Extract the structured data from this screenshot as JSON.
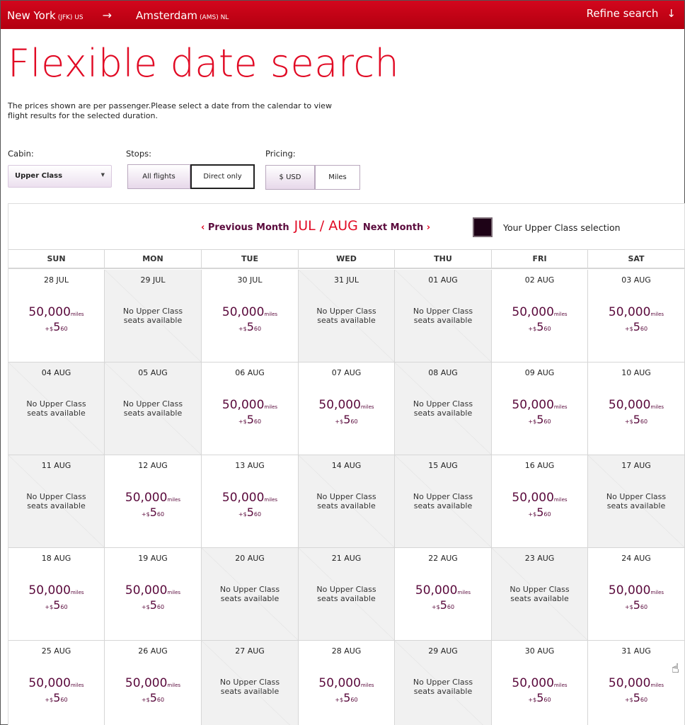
{
  "header": {
    "origin_city": "New York",
    "origin_code": "(JFK) US",
    "arrow": "→",
    "dest_city": "Amsterdam",
    "dest_code": "(AMS) NL",
    "refine_label": "Refine search",
    "refine_icon": "↓"
  },
  "title": "Flexible date search",
  "description": "The prices shown are per passenger.Please select a date from the calendar to view flight results for the selected duration.",
  "filters": {
    "cabin_label": "Cabin:",
    "cabin_value": "Upper Class",
    "stops_label": "Stops:",
    "stops_options": [
      "All flights",
      "Direct only"
    ],
    "pricing_label": "Pricing:",
    "pricing_options": [
      "$ USD",
      "Miles"
    ]
  },
  "calendar": {
    "prev_label": "Previous Month",
    "next_label": "Next Month",
    "month_label": "JUL / AUG",
    "legend_label": "Your Upper Class selection",
    "days_of_week": [
      "SUN",
      "MON",
      "TUE",
      "WED",
      "THU",
      "FRI",
      "SAT"
    ],
    "no_seats_text": "No Upper Class seats available",
    "price_miles": "50,000",
    "miles_unit": "miles",
    "tax_prefix": "+$",
    "tax_dollars": "5",
    "tax_cents": "60",
    "cells": [
      {
        "date": "28 JUL",
        "available": true
      },
      {
        "date": "29 JUL",
        "available": false
      },
      {
        "date": "30 JUL",
        "available": true
      },
      {
        "date": "31 JUL",
        "available": false
      },
      {
        "date": "01 AUG",
        "available": false
      },
      {
        "date": "02 AUG",
        "available": true
      },
      {
        "date": "03 AUG",
        "available": true
      },
      {
        "date": "04 AUG",
        "available": false
      },
      {
        "date": "05 AUG",
        "available": false
      },
      {
        "date": "06 AUG",
        "available": true
      },
      {
        "date": "07 AUG",
        "available": true
      },
      {
        "date": "08 AUG",
        "available": false
      },
      {
        "date": "09 AUG",
        "available": true
      },
      {
        "date": "10 AUG",
        "available": true
      },
      {
        "date": "11 AUG",
        "available": false
      },
      {
        "date": "12 AUG",
        "available": true
      },
      {
        "date": "13 AUG",
        "available": true
      },
      {
        "date": "14 AUG",
        "available": false
      },
      {
        "date": "15 AUG",
        "available": false
      },
      {
        "date": "16 AUG",
        "available": true
      },
      {
        "date": "17 AUG",
        "available": false
      },
      {
        "date": "18 AUG",
        "available": true
      },
      {
        "date": "19 AUG",
        "available": true
      },
      {
        "date": "20 AUG",
        "available": false
      },
      {
        "date": "21 AUG",
        "available": false
      },
      {
        "date": "22 AUG",
        "available": true
      },
      {
        "date": "23 AUG",
        "available": false
      },
      {
        "date": "24 AUG",
        "available": true
      },
      {
        "date": "25 AUG",
        "available": true
      },
      {
        "date": "26 AUG",
        "available": true
      },
      {
        "date": "27 AUG",
        "available": false
      },
      {
        "date": "28 AUG",
        "available": true
      },
      {
        "date": "29 AUG",
        "available": false
      },
      {
        "date": "30 AUG",
        "available": true
      },
      {
        "date": "31 AUG",
        "available": true
      }
    ]
  },
  "colors": {
    "brand_red": "#e10a24",
    "price_purple": "#5a0a3c",
    "legend_swatch": "#1e0317",
    "unavailable_bg": "#f1f1f1"
  }
}
